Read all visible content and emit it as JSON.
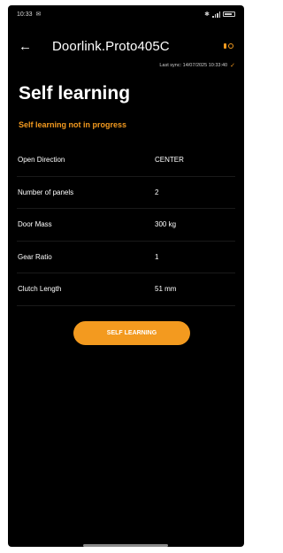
{
  "status_bar": {
    "time": "10:33",
    "left_icon": "notification-icon",
    "right_icons": [
      "bluetooth-icon",
      "signal-icon",
      "battery-icon"
    ]
  },
  "header": {
    "title": "Doorlink.Proto405C",
    "back_icon": "back-arrow-icon",
    "connection_icon": "connection-status-icon"
  },
  "sync": {
    "text": "Last sync: 14/07/2025 10:33:40"
  },
  "page": {
    "title": "Self learning",
    "status": "Self learning not in progress"
  },
  "details": [
    {
      "label": "Open Direction",
      "value": "CENTER"
    },
    {
      "label": "Number of panels",
      "value": "2"
    },
    {
      "label": "Door Mass",
      "value": "300 kg"
    },
    {
      "label": "Gear Ratio",
      "value": "1"
    },
    {
      "label": "Clutch Length",
      "value": "51 mm"
    }
  ],
  "actions": {
    "self_learning_label": "SELF LEARNING"
  },
  "colors": {
    "accent": "#f39a1f",
    "background": "#000000",
    "text": "#ffffff"
  }
}
